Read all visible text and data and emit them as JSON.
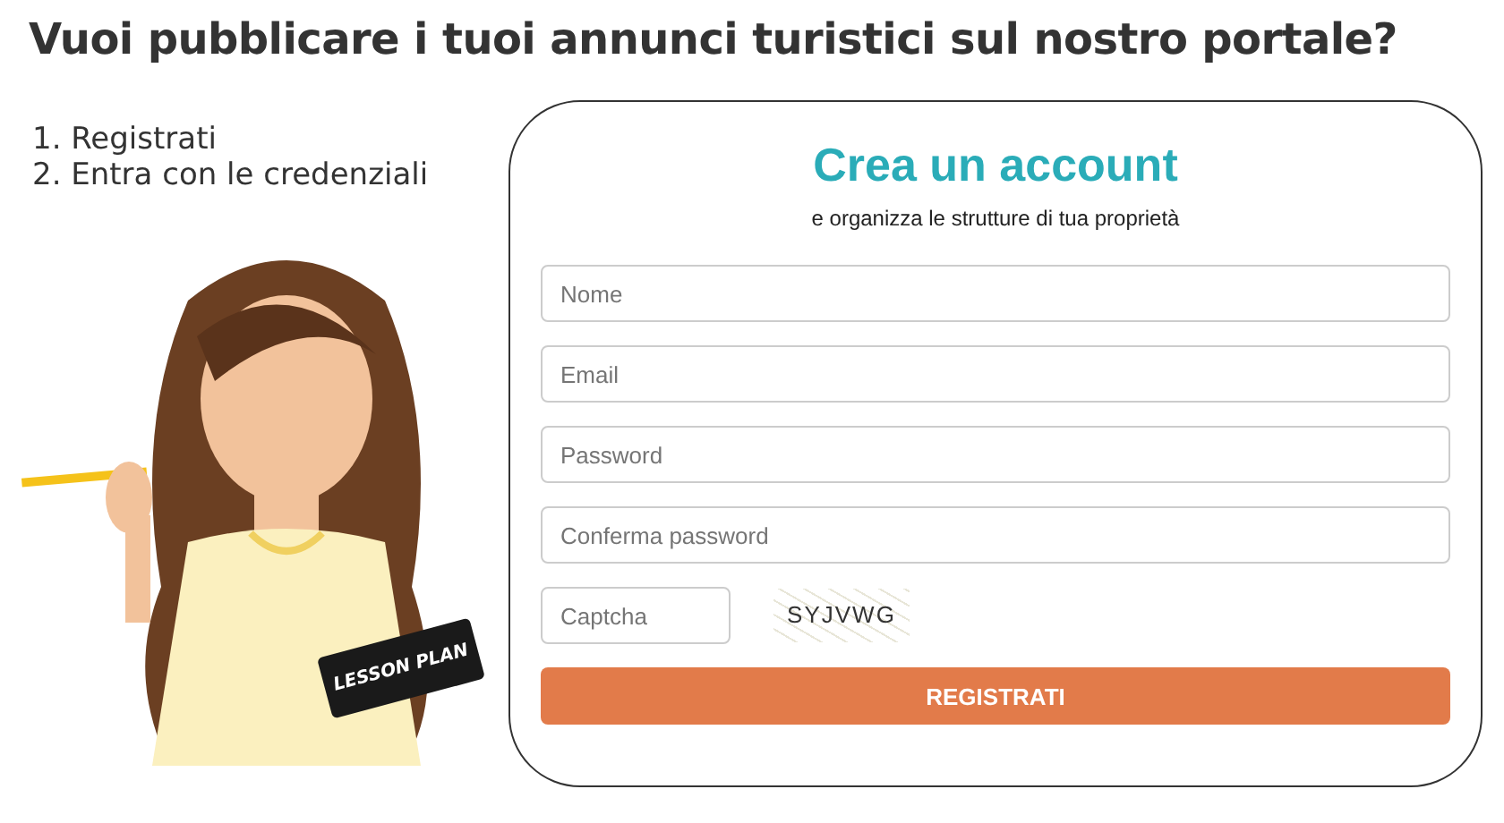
{
  "headline": "Vuoi pubblicare i tuoi annunci turistici sul nostro portale?",
  "steps": [
    "1. Registrati",
    "2. Entra con le credenziali"
  ],
  "illustration": {
    "book_label": "LESSON PLAN"
  },
  "form": {
    "title": "Crea un account",
    "subtitle": "e organizza le strutture di tua proprietà",
    "fields": [
      {
        "placeholder": "Nome"
      },
      {
        "placeholder": "Email"
      },
      {
        "placeholder": "Password"
      },
      {
        "placeholder": "Conferma password"
      }
    ],
    "captcha": {
      "placeholder": "Captcha",
      "code": "SYJVWG"
    },
    "submit": "REGISTRATI"
  }
}
